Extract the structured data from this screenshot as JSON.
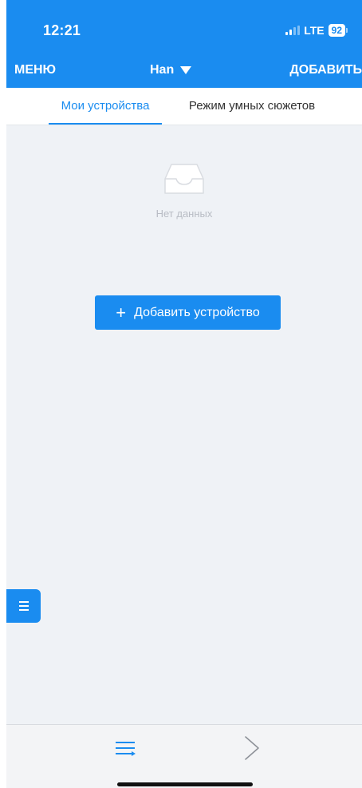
{
  "status_bar": {
    "time": "12:21",
    "network": "LTE",
    "battery": "92"
  },
  "header": {
    "menu_label": "МЕНЮ",
    "home_name": "Han",
    "add_label": "ДОБАВИТЬ"
  },
  "tabs": [
    {
      "label": "Мои устройства",
      "active": true
    },
    {
      "label": "Режим умных сюжетов",
      "active": false
    }
  ],
  "empty_state": {
    "icon": "inbox-icon",
    "text": "Нет данных"
  },
  "add_device_button": {
    "icon": "plus-icon",
    "label": "Добавить устройство"
  },
  "floating_button": {
    "icon": "menu-icon"
  },
  "bottom_bar": {
    "items": [
      {
        "icon": "menu-lines-icon"
      },
      {
        "icon": "chevron-right-icon"
      }
    ]
  },
  "colors": {
    "accent": "#1a8cf0",
    "background": "#eff2f6",
    "tab_text": "#333333",
    "empty_text": "#b8bcc4"
  }
}
